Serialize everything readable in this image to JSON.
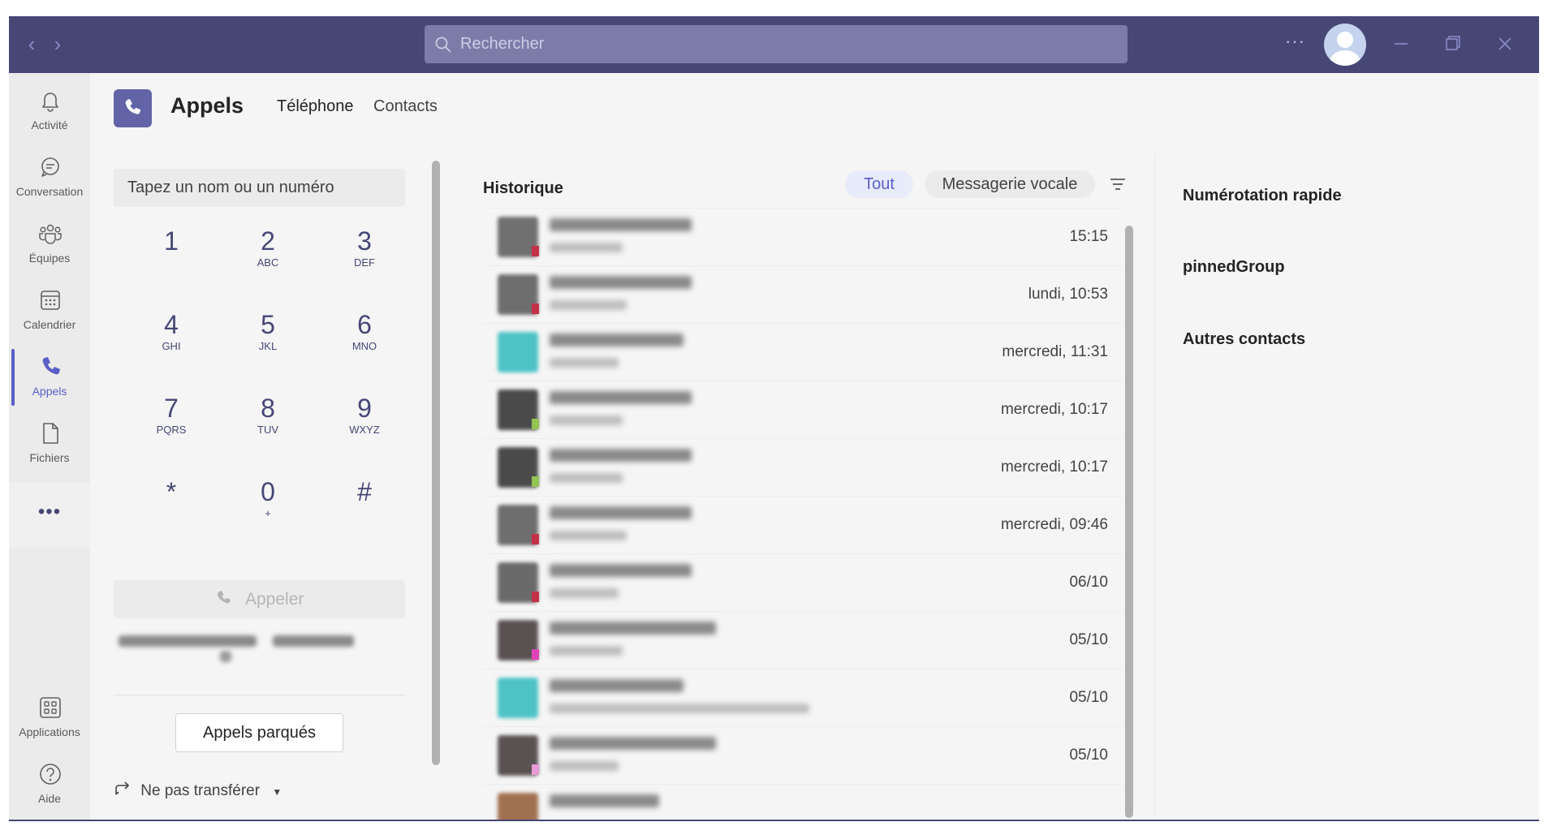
{
  "titlebar": {
    "search_placeholder": "Rechercher",
    "more_label": "···"
  },
  "rail": {
    "items": [
      {
        "label": "Activité",
        "icon": "bell-icon"
      },
      {
        "label": "Conversation",
        "icon": "chat-icon"
      },
      {
        "label": "Équipes",
        "icon": "teams-icon"
      },
      {
        "label": "Calendrier",
        "icon": "calendar-icon"
      },
      {
        "label": "Appels",
        "icon": "phone-icon",
        "active": true
      },
      {
        "label": "Fichiers",
        "icon": "file-icon"
      }
    ],
    "more_label": "•••",
    "bottom": [
      {
        "label": "Applications",
        "icon": "apps-icon"
      },
      {
        "label": "Aide",
        "icon": "help-icon"
      }
    ]
  },
  "header": {
    "title": "Appels",
    "tabs": [
      {
        "label": "Téléphone",
        "active": true
      },
      {
        "label": "Contacts",
        "active": false
      }
    ]
  },
  "dialpad": {
    "placeholder": "Tapez un nom ou un numéro",
    "keys": [
      {
        "digit": "1",
        "letters": ""
      },
      {
        "digit": "2",
        "letters": "ABC"
      },
      {
        "digit": "3",
        "letters": "DEF"
      },
      {
        "digit": "4",
        "letters": "GHI"
      },
      {
        "digit": "5",
        "letters": "JKL"
      },
      {
        "digit": "6",
        "letters": "MNO"
      },
      {
        "digit": "7",
        "letters": "PQRS"
      },
      {
        "digit": "8",
        "letters": "TUV"
      },
      {
        "digit": "9",
        "letters": "WXYZ"
      },
      {
        "digit": "*",
        "letters": ""
      },
      {
        "digit": "0",
        "letters": "+"
      },
      {
        "digit": "#",
        "letters": ""
      }
    ],
    "call_label": "Appeler",
    "parked_label": "Appels parqués",
    "forward_label": "Ne pas transférer"
  },
  "history": {
    "title": "Historique",
    "filter_all": "Tout",
    "filter_voicemail": "Messagerie vocale",
    "times": [
      "15:15",
      "lundi, 10:53",
      "mercredi, 11:31",
      "mercredi, 10:17",
      "mercredi, 10:17",
      "mercredi, 09:46",
      "06/10",
      "05/10",
      "05/10",
      "05/10"
    ],
    "colors": {
      "accent": "#5b5fc7",
      "titlebar": "#464775",
      "missed": "#c4314b",
      "available": "#92c353"
    }
  },
  "right": {
    "speed_dial": "Numérotation rapide",
    "pinned": "pinnedGroup",
    "other": "Autres contacts"
  }
}
